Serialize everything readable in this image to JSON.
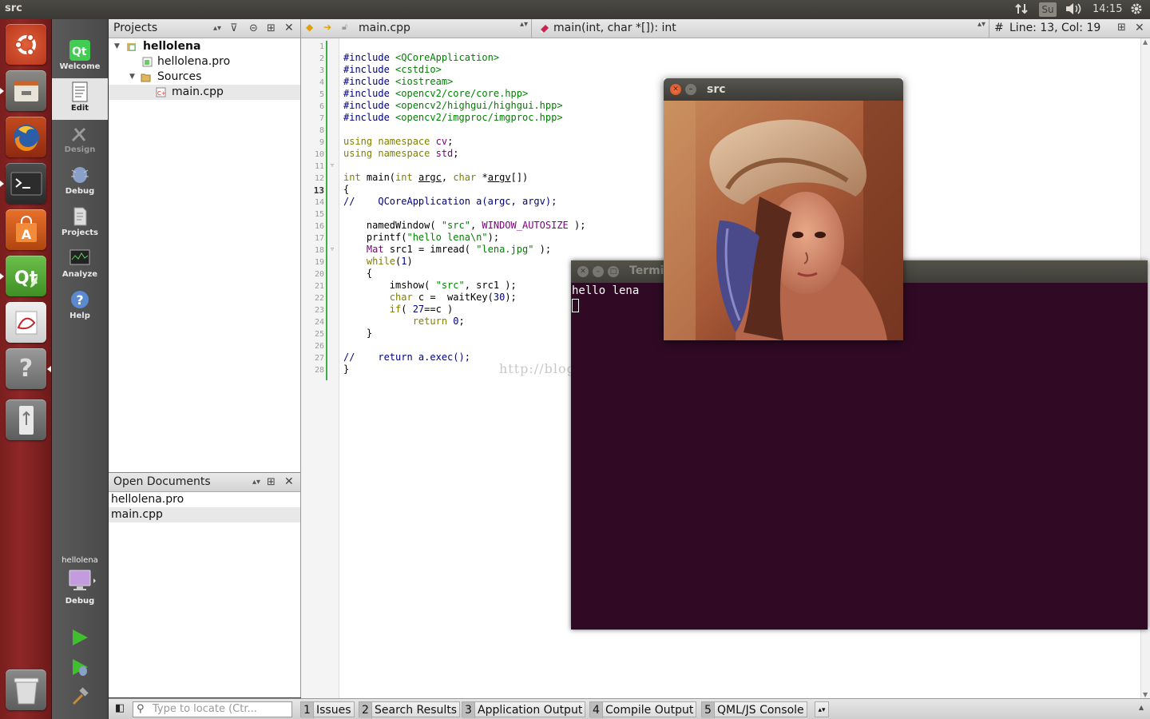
{
  "topbar": {
    "window_title": "src",
    "keyboard": "Su",
    "clock": "14:15"
  },
  "launcher": {
    "items": [
      "ubuntu-dash",
      "files",
      "firefox",
      "terminal",
      "software-center",
      "qt-creator",
      "document-viewer",
      "help",
      "usb-drive",
      "trash"
    ]
  },
  "modes": [
    {
      "label": "Welcome"
    },
    {
      "label": "Edit"
    },
    {
      "label": "Design"
    },
    {
      "label": "Debug"
    },
    {
      "label": "Projects"
    },
    {
      "label": "Analyze"
    },
    {
      "label": "Help"
    }
  ],
  "kit": {
    "project": "hellolena",
    "mode": "Debug"
  },
  "projects_pane": {
    "title": "Projects",
    "tree": [
      {
        "label": "hellolena",
        "bold": true
      },
      {
        "label": "hellolena.pro"
      },
      {
        "label": "Sources"
      },
      {
        "label": "main.cpp",
        "selected": true
      }
    ]
  },
  "open_documents": {
    "title": "Open Documents",
    "items": [
      "hellolena.pro",
      "main.cpp"
    ]
  },
  "editor": {
    "file": "main.cpp",
    "symbol": "main(int, char *[]): int",
    "hash": "#",
    "position": "Line: 13, Col: 19",
    "current_line": 13,
    "line_numbers": [
      "1",
      "2",
      "3",
      "4",
      "5",
      "6",
      "7",
      "8",
      "9",
      "10",
      "11",
      "12",
      "13",
      "14",
      "15",
      "16",
      "17",
      "18",
      "19",
      "20",
      "21",
      "22",
      "23",
      "24",
      "25",
      "26",
      "27",
      "28"
    ]
  },
  "watermark": "http://blog.csdn.net/",
  "terminal": {
    "title": "Termi",
    "output": "hello lena"
  },
  "image_window": {
    "title": "src"
  },
  "locator": {
    "placeholder": "Type to locate (Ctr..."
  },
  "output_tabs": [
    {
      "num": "1",
      "label": "Issues"
    },
    {
      "num": "2",
      "label": "Search Results"
    },
    {
      "num": "3",
      "label": "Application Output"
    },
    {
      "num": "4",
      "label": "Compile Output"
    },
    {
      "num": "5",
      "label": "QML/JS Console"
    }
  ]
}
